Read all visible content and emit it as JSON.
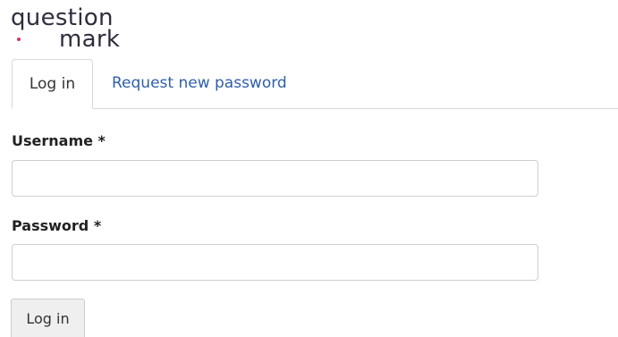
{
  "logo": {
    "line1": "question",
    "line2": "mark",
    "accent_color": "#d6336c"
  },
  "tabs": [
    {
      "label": "Log in",
      "active": true
    },
    {
      "label": "Request new password",
      "active": false
    }
  ],
  "form": {
    "username_label": "Username *",
    "username_value": "",
    "password_label": "Password *",
    "password_value": "",
    "submit_label": "Log in"
  },
  "colors": {
    "link": "#2f5fa8",
    "border": "#d9d9d9",
    "button_bg": "#efefef"
  }
}
